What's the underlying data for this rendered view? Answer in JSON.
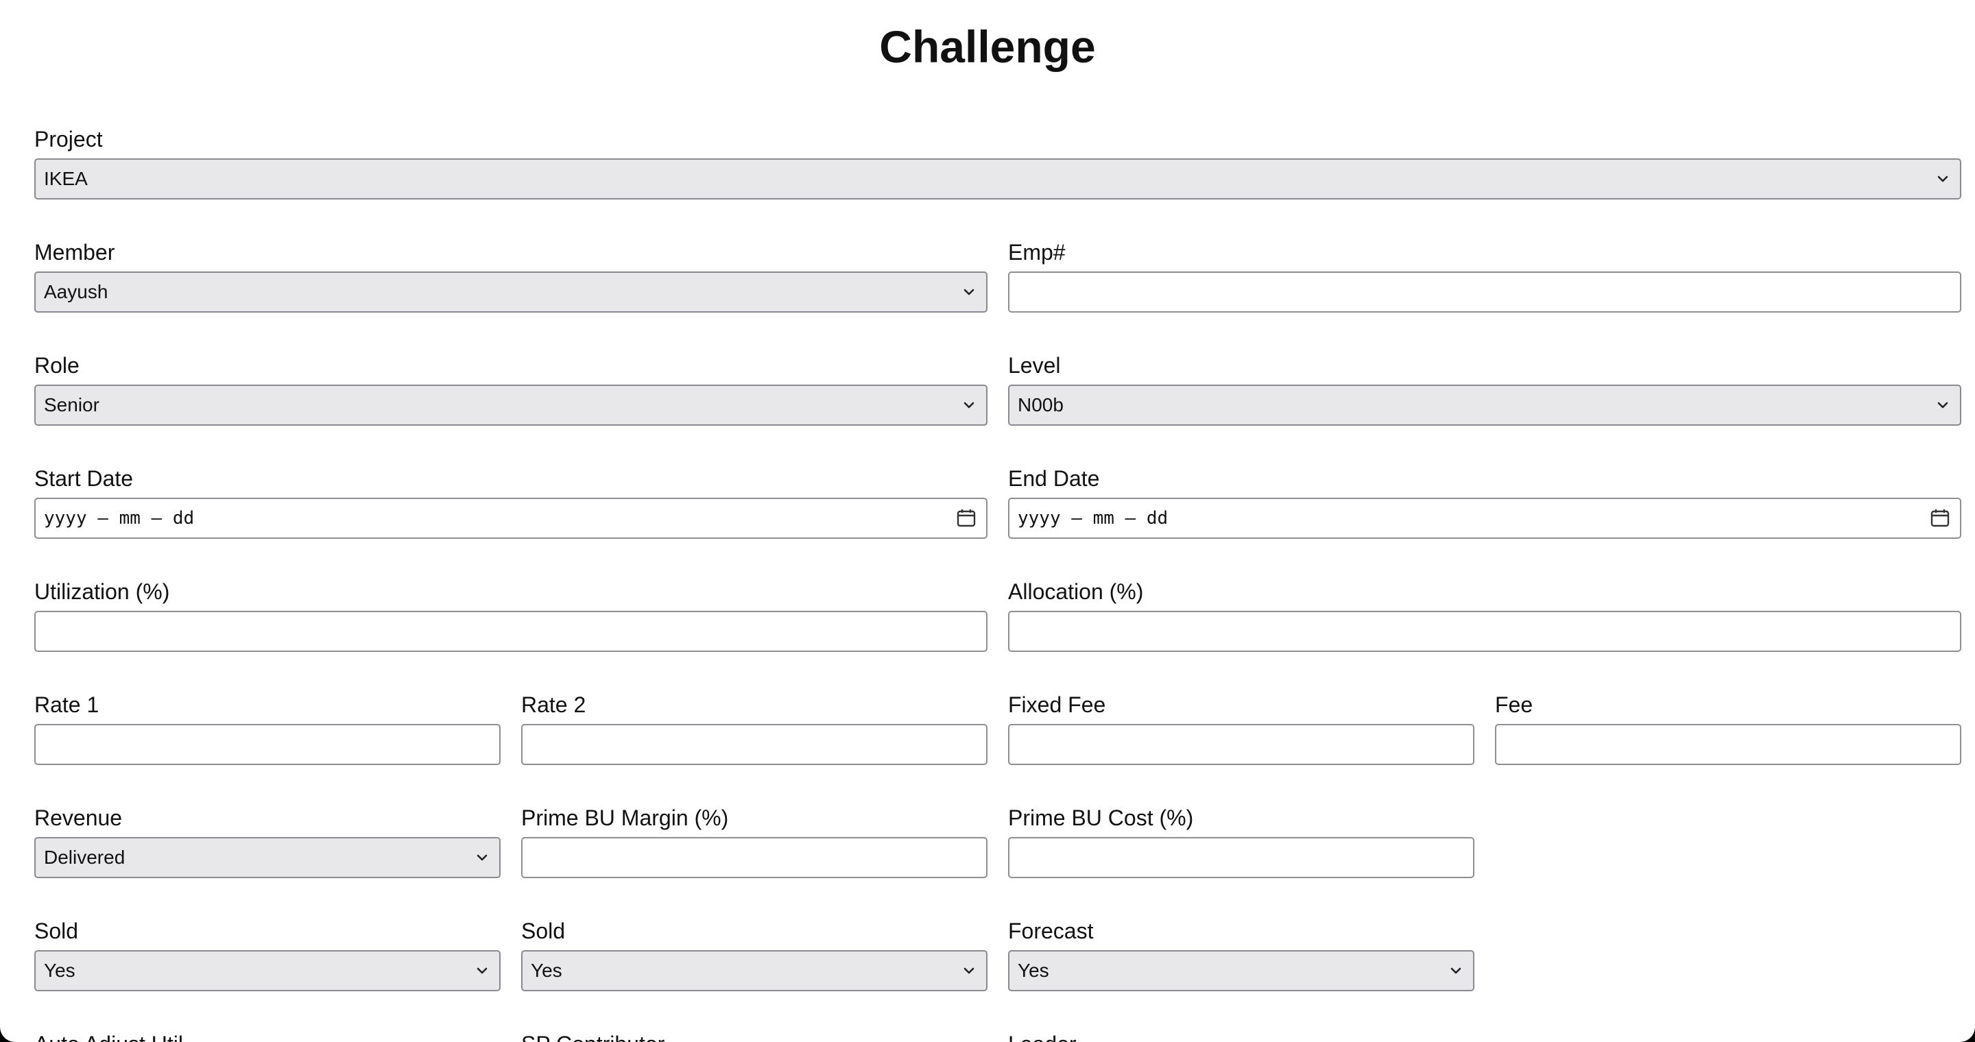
{
  "page": {
    "title": "Challenge"
  },
  "form": {
    "project": {
      "label": "Project",
      "value": "IKEA"
    },
    "member": {
      "label": "Member",
      "value": "Aayush"
    },
    "emp": {
      "label": "Emp#",
      "value": ""
    },
    "role": {
      "label": "Role",
      "value": "Senior"
    },
    "level": {
      "label": "Level",
      "value": "N00b"
    },
    "start_date": {
      "label": "Start Date",
      "placeholder": "yyyy – mm – dd"
    },
    "end_date": {
      "label": "End Date",
      "placeholder": "yyyy – mm – dd"
    },
    "utilization": {
      "label": "Utilization (%)",
      "value": ""
    },
    "allocation": {
      "label": "Allocation (%)",
      "value": ""
    },
    "rate1": {
      "label": "Rate 1",
      "value": ""
    },
    "rate2": {
      "label": "Rate 2",
      "value": ""
    },
    "fixed_fee": {
      "label": "Fixed Fee",
      "value": ""
    },
    "fee": {
      "label": "Fee",
      "value": ""
    },
    "revenue": {
      "label": "Revenue",
      "value": "Delivered"
    },
    "prime_bu_margin": {
      "label": "Prime BU Margin (%)",
      "value": ""
    },
    "prime_bu_cost": {
      "label": "Prime BU Cost (%)",
      "value": ""
    },
    "sold1": {
      "label": "Sold",
      "value": "Yes"
    },
    "sold2": {
      "label": "Sold",
      "value": "Yes"
    },
    "forecast": {
      "label": "Forecast",
      "value": "Yes"
    },
    "auto_adjust": {
      "label": "Auto Adjust Util"
    },
    "sp_contributor": {
      "label": "SP Contributor"
    },
    "leader": {
      "label": "Leader"
    }
  }
}
